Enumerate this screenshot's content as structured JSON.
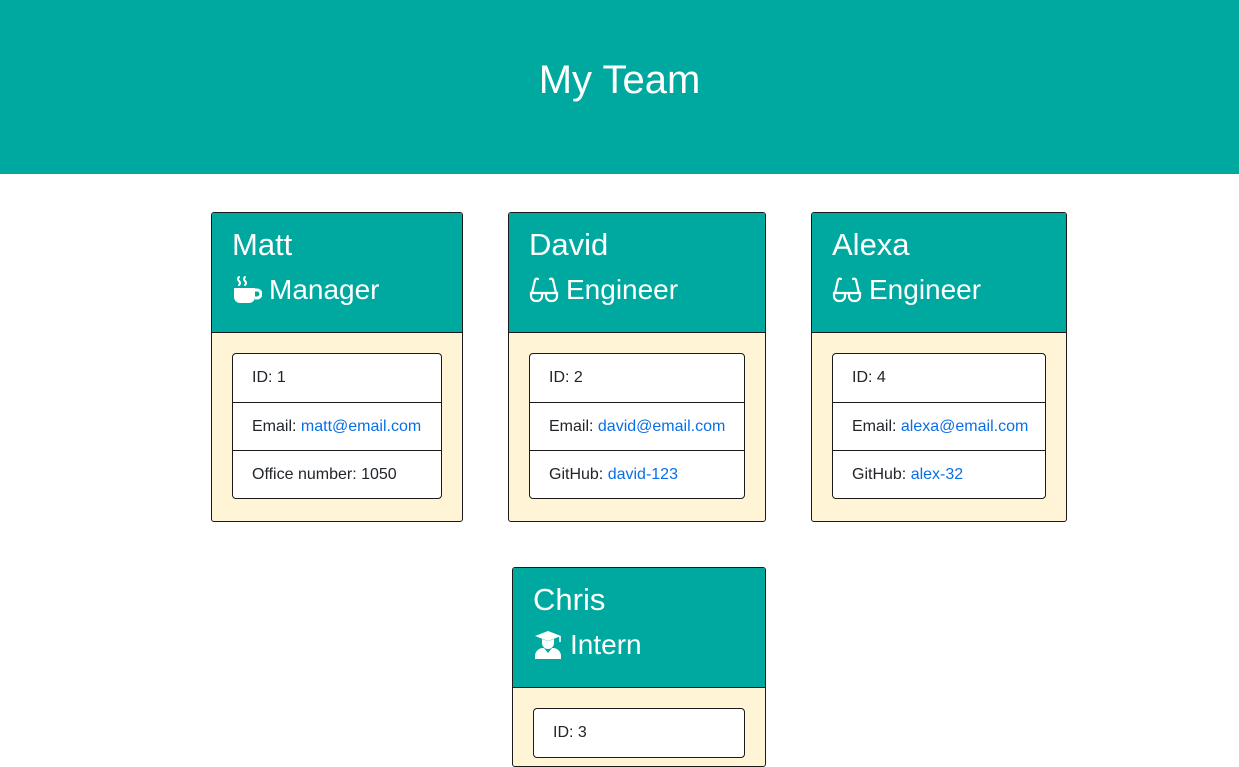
{
  "header": {
    "title": "My Team"
  },
  "colors": {
    "header_bg": "#00a9a0",
    "card_body_bg": "#fff5d6",
    "link": "#0a6fe6"
  },
  "employees": [
    {
      "name": "Matt",
      "role": "Manager",
      "icon": "mug-icon",
      "id_label": "ID: 1",
      "email_label": "Email: ",
      "email": "matt@email.com",
      "extra_label": "Office number: 1050",
      "extra_link": ""
    },
    {
      "name": "David",
      "role": "Engineer",
      "icon": "glasses-icon",
      "id_label": "ID: 2",
      "email_label": "Email: ",
      "email": "david@email.com",
      "extra_label": "GitHub: ",
      "extra_link": "david-123"
    },
    {
      "name": "Alexa",
      "role": "Engineer",
      "icon": "glasses-icon",
      "id_label": "ID: 4",
      "email_label": "Email: ",
      "email": "alexa@email.com",
      "extra_label": "GitHub: ",
      "extra_link": "alex-32"
    },
    {
      "name": "Chris",
      "role": "Intern",
      "icon": "graduate-icon",
      "id_label": "ID: 3"
    }
  ]
}
